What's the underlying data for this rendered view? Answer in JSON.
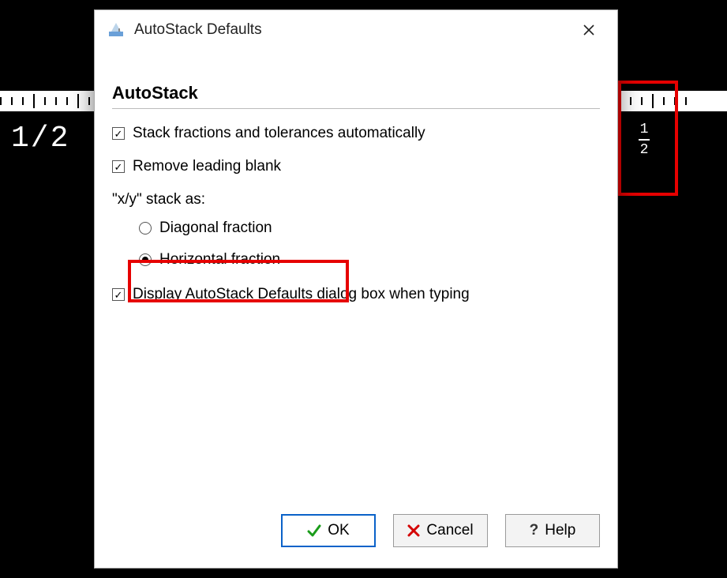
{
  "background": {
    "typed_fraction": "1/2",
    "preview_numerator": "1",
    "preview_denominator": "2"
  },
  "dialog": {
    "title": "AutoStack Defaults",
    "section": "AutoStack",
    "stack_auto_label": "Stack fractions and tolerances automatically",
    "stack_auto_checked": true,
    "remove_blank_label": "Remove leading blank",
    "remove_blank_checked": true,
    "stack_as_label": "\"x/y\" stack as:",
    "radio_diagonal_label": "Diagonal fraction",
    "radio_horizontal_label": "Horizontal fraction",
    "radio_selected": "horizontal",
    "display_dialog_label": "Display AutoStack Defaults dialog box when typing",
    "display_dialog_checked": true,
    "buttons": {
      "ok": "OK",
      "cancel": "Cancel",
      "help": "Help"
    }
  }
}
